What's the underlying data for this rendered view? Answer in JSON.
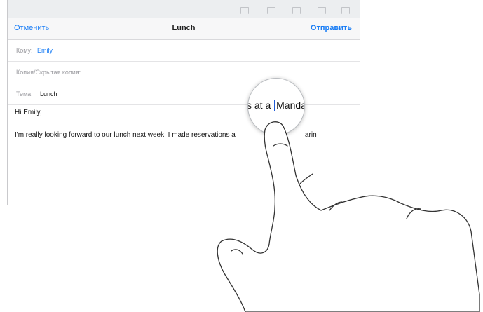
{
  "navbar": {
    "cancel": "Отменить",
    "title": "Lunch",
    "send": "Отправить"
  },
  "fields": {
    "to_label": "Кому:",
    "to_value": "Emily",
    "cc_label": "Копия/Скрытая копия:",
    "subject_label": "Тема:",
    "subject_value": "Lunch"
  },
  "body": {
    "greeting": "Hi Emily,",
    "paragraph": "I'm really looking forward to our lunch next week. I made reservations a",
    "paragraph_end": "arin"
  },
  "loupe": {
    "before": "s at a ",
    "after": "Manda"
  },
  "colors": {
    "accent": "#1b7ef5",
    "caret": "#1e5bd8"
  }
}
